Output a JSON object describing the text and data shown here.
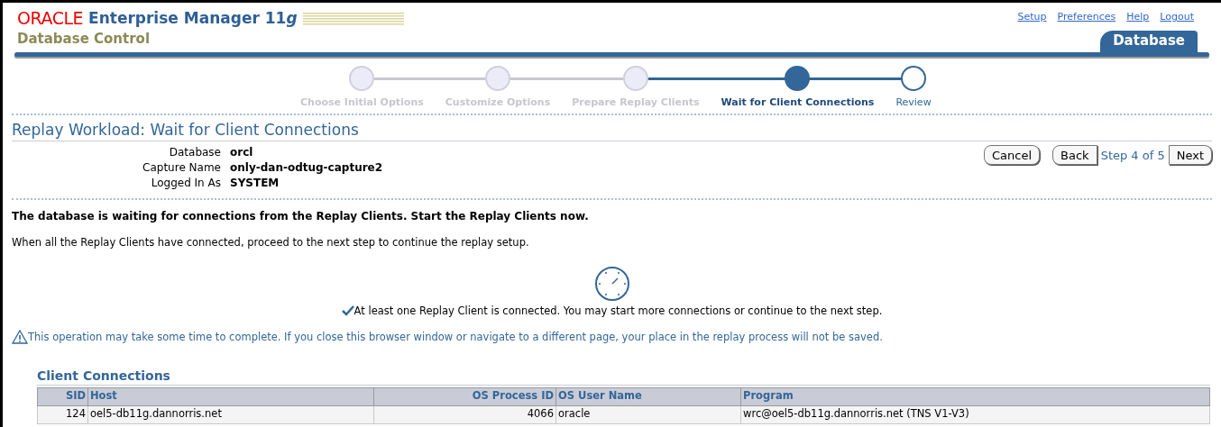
{
  "header": {
    "brand": "ORACLE",
    "product": "Enterprise Manager 11",
    "product_suffix": "g",
    "subtitle": "Database Control",
    "links": [
      "Setup",
      "Preferences",
      "Help",
      "Logout"
    ],
    "tab": "Database"
  },
  "train": [
    {
      "label": "Choose Initial Options",
      "visited": true,
      "selected": false
    },
    {
      "label": "Customize Options",
      "visited": true,
      "selected": false
    },
    {
      "label": "Prepare Replay Clients",
      "visited": true,
      "selected": false
    },
    {
      "label": "Wait for Client Connections",
      "visited": false,
      "selected": true
    },
    {
      "label": "Review",
      "visited": false,
      "selected": false
    }
  ],
  "page_title": "Replay Workload: Wait for Client Connections",
  "info": [
    {
      "label": "Database",
      "value": "orcl"
    },
    {
      "label": "Capture Name",
      "value": "only-dan-odtug-capture2"
    },
    {
      "label": "Logged In As",
      "value": "SYSTEM"
    }
  ],
  "actions": {
    "cancel": "Cancel",
    "back": "Back",
    "step": "Step 4 of 5",
    "next": "Next"
  },
  "instruction": "The database is waiting for connections from the Replay Clients. Start the Replay Clients now.",
  "hint": "When all the Replay Clients have connected, proceed to the next step to continue the replay setup.",
  "status": "At least one Replay Client is connected. You may start more connections or continue to the next step.",
  "warning": "This operation may take some time to complete. If you close this browser window or navigate to a different page, your place in the replay process will not be saved.",
  "table": {
    "title": "Client Connections",
    "columns": [
      {
        "label": "SID",
        "numeric": true
      },
      {
        "label": "Host",
        "numeric": false
      },
      {
        "label": "OS Process ID",
        "numeric": true
      },
      {
        "label": "OS User Name",
        "numeric": false
      },
      {
        "label": "Program",
        "numeric": false
      }
    ],
    "rows": [
      [
        "124",
        "oel5-db11g.dannorris.net",
        "4066",
        "oracle",
        "wrc@oel5-db11g.dannorris.net (TNS V1-V3)"
      ]
    ]
  }
}
